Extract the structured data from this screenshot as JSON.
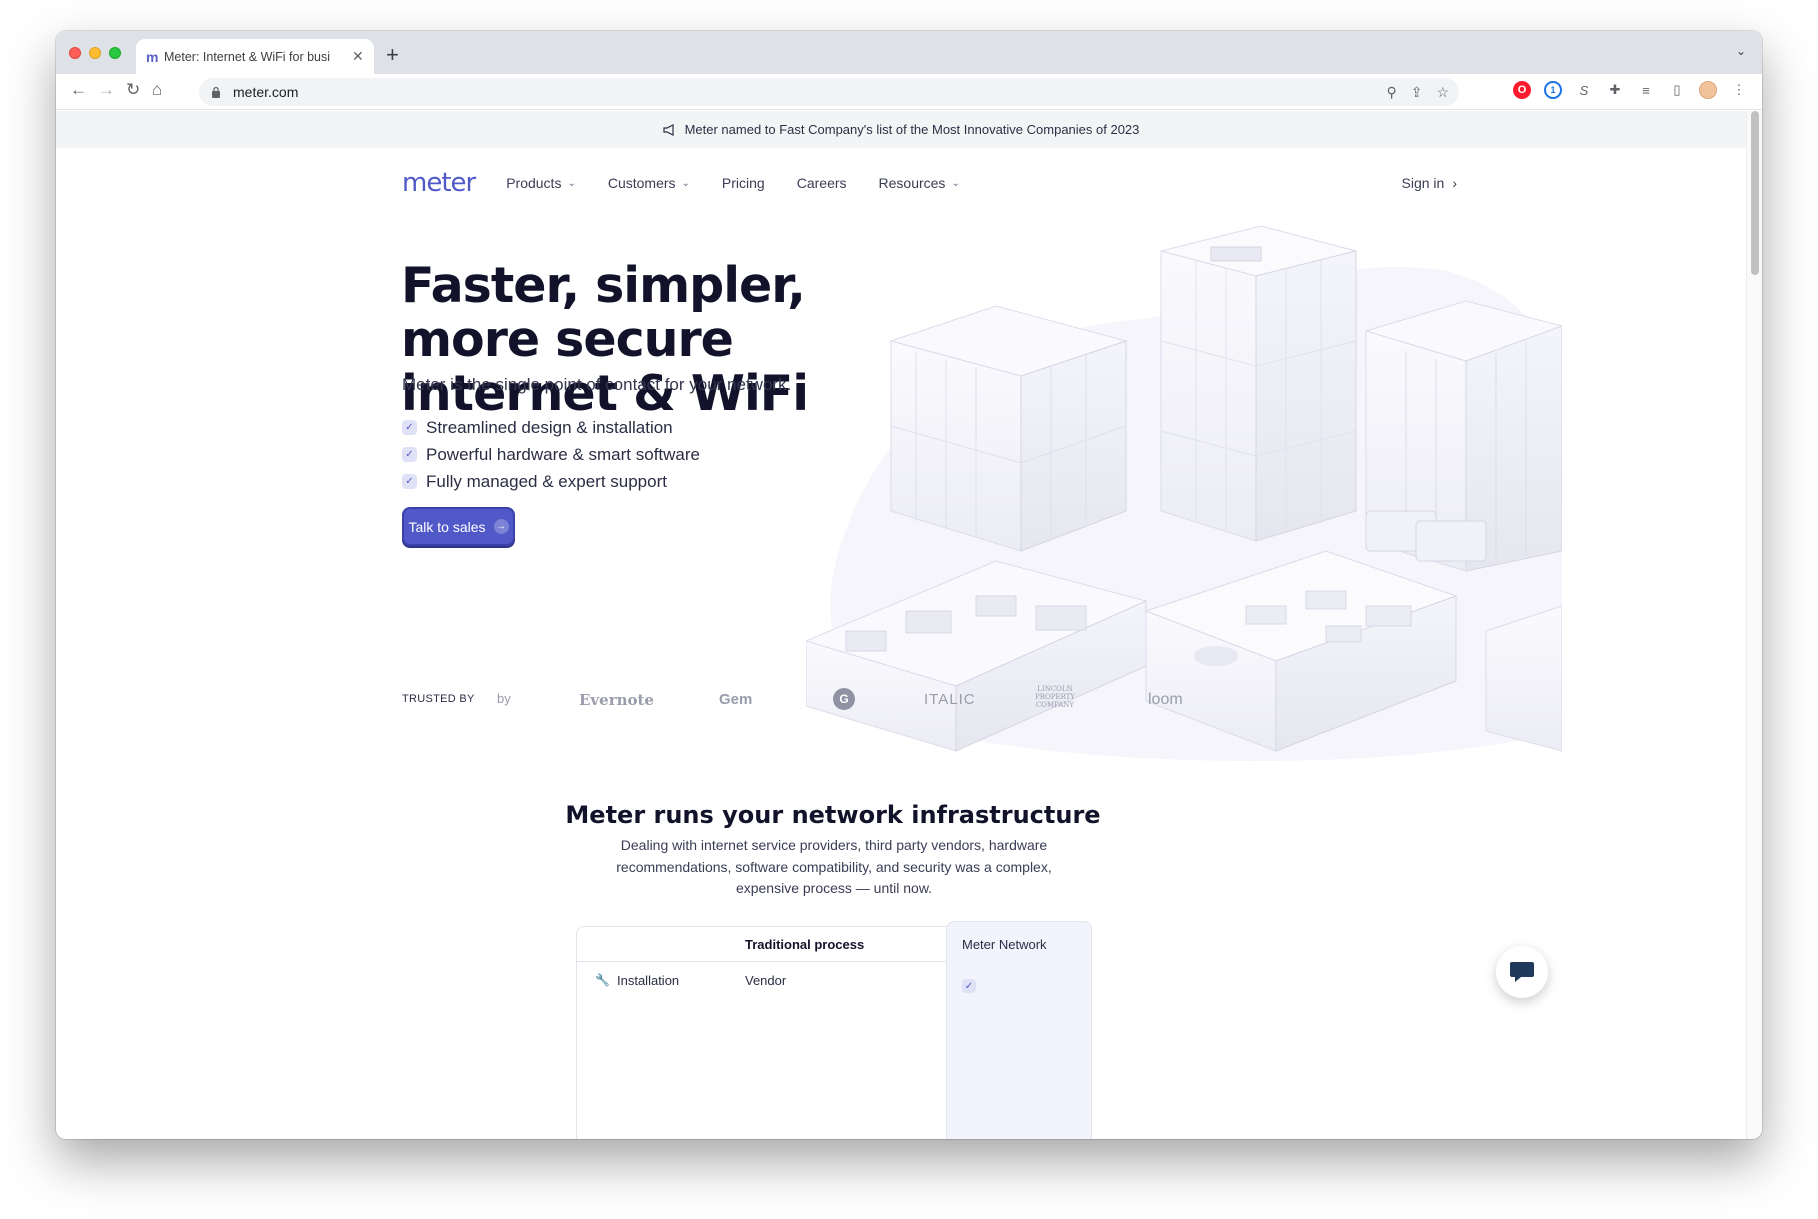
{
  "browser": {
    "tab_title": "Meter: Internet & WiFi for busi",
    "tab_favicon": "m",
    "url": "meter.com",
    "extensions": [
      "opera-icon",
      "1password-icon",
      "s-icon",
      "puzzle-icon",
      "media-icon",
      "sidepanel-icon",
      "profile-avatar"
    ]
  },
  "banner": {
    "text": "Meter named to Fast Company's list of the Most Innovative Companies of 2023"
  },
  "nav": {
    "logo": "meter",
    "items": [
      {
        "label": "Products",
        "dropdown": true
      },
      {
        "label": "Customers",
        "dropdown": true
      },
      {
        "label": "Pricing",
        "dropdown": false
      },
      {
        "label": "Careers",
        "dropdown": false
      },
      {
        "label": "Resources",
        "dropdown": true
      }
    ],
    "sign_in": "Sign in"
  },
  "hero": {
    "title": "Faster, simpler, more secure internet & WiFi",
    "subtitle": "Meter is the single point of contact for your network.",
    "checklist": [
      "Streamlined design & installation",
      "Powerful hardware & smart software",
      "Fully managed & expert support"
    ],
    "cta": "Talk to sales"
  },
  "trusted": {
    "label": "TRUSTED BY",
    "logos": [
      "by",
      "Evernote",
      "Gem",
      "G",
      "ITALIC",
      "LINCOLN PROPERTY COMPANY",
      "loom"
    ]
  },
  "infra": {
    "title": "Meter runs your network infrastructure",
    "text": "Dealing with internet service providers, third party vendors, hardware recommendations, software compatibility, and security was a complex, expensive process — until now."
  },
  "table": {
    "col_traditional": "Traditional process",
    "col_meter": "Meter Network",
    "rows": [
      {
        "label": "Installation",
        "traditional": "Vendor",
        "meter": true
      }
    ]
  },
  "colors": {
    "accent": "#5159c9",
    "heading": "#12132a",
    "banner_bg": "#f3f4f6"
  }
}
